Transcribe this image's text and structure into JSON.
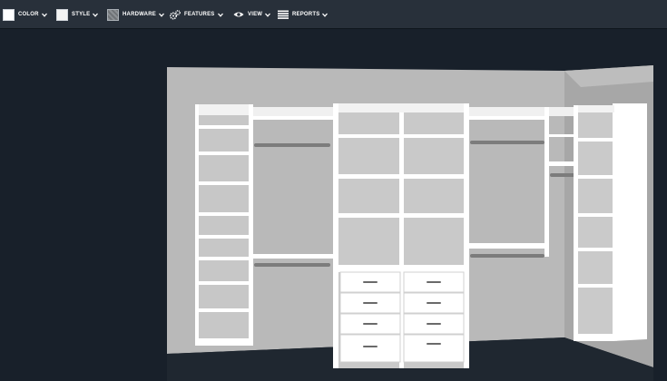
{
  "toolbar": {
    "color_label": "COLOR",
    "style_label": "STYLE",
    "hardware_label": "HARDWARE",
    "features_label": "FEATURES",
    "view_label": "VIEW",
    "reports_label": "REPORTS"
  },
  "colors": {
    "toolbar_bg": "#28303a",
    "canvas_bg": "#18202a",
    "wall": "#b9b9b9",
    "cabinet": "#ffffff",
    "shelf_interior": "#c8c8c8",
    "rod": "#7c7c7c"
  },
  "icons": {
    "color": "color-swatch-icon",
    "style": "style-swatch-icon",
    "hardware": "hardware-texture-icon",
    "features": "gears-icon",
    "view": "eye-icon",
    "reports": "list-icon",
    "dropdown": "chevron-down-icon"
  }
}
